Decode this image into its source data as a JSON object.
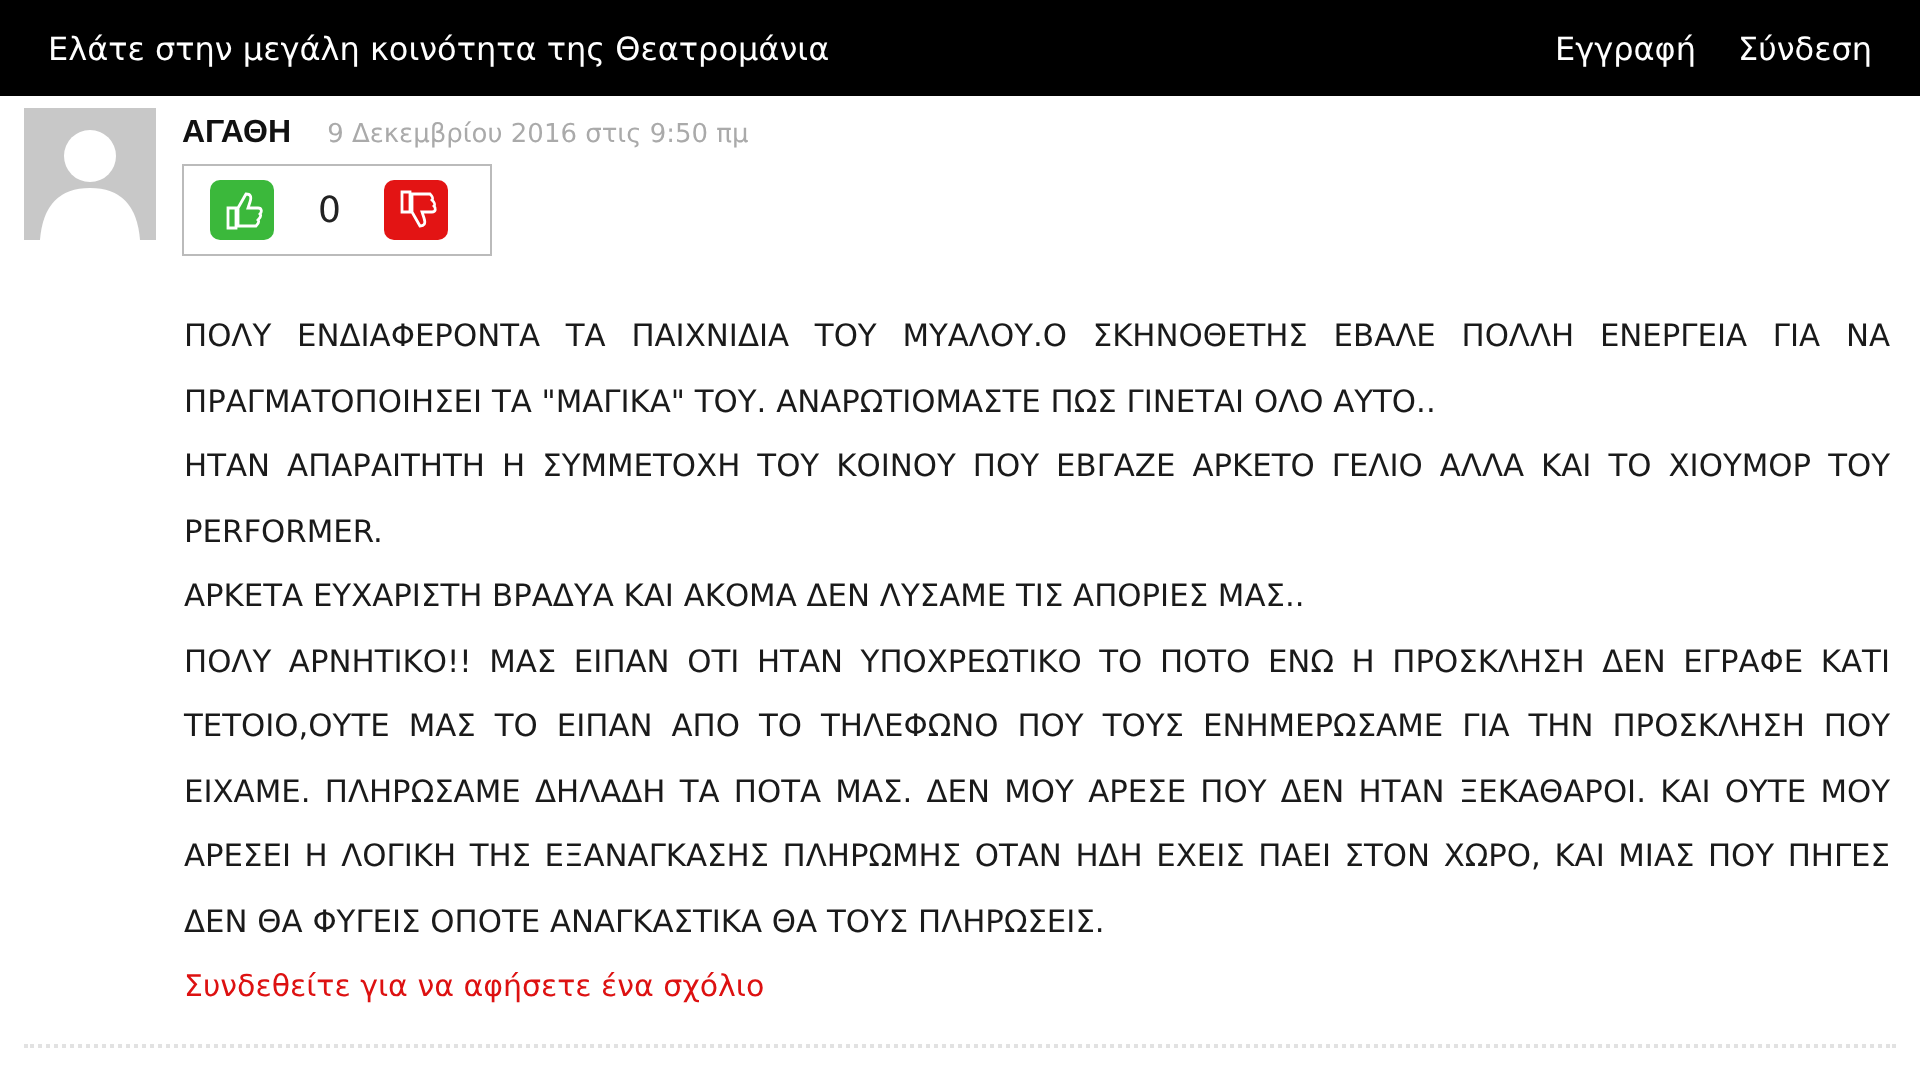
{
  "header": {
    "title": "Ελάτε στην μεγάλη κοινότητα της Θεατρομάνια",
    "links": [
      "Εγγραφή",
      "Σύνδεση"
    ]
  },
  "comment": {
    "author": "ΑΓΑΘΗ",
    "date": "9 Δεκεμβρίου 2016 στις 9:50 πμ",
    "votes": "0",
    "paragraphs": [
      "ΠΟΛΥ ΕΝΔΙΑΦΕΡΟΝΤΑ ΤΑ ΠΑΙΧΝΙΔΙΑ ΤΟΥ ΜΥΑΛΟΥ.Ο ΣΚΗΝΟΘΕΤΗΣ ΕΒΑΛΕ ΠΟΛΛΗ ΕΝΕΡΓΕΙΑ ΓΙΑ ΝΑ ΠΡΑΓΜΑΤΟΠΟΙΗΣΕΙ ΤΑ \"ΜΑΓΙΚΑ\" ΤΟΥ. ΑΝΑΡΩΤΙΟΜΑΣΤΕ ΠΩΣ ΓΙΝΕΤΑΙ ΟΛΟ ΑΥΤΟ..",
      "ΗΤΑΝ ΑΠΑΡΑΙΤΗΤΗ Η ΣΥΜΜΕΤΟΧΗ ΤΟΥ ΚΟΙΝΟΥ ΠΟΥ ΕΒΓΑΖΕ ΑΡΚΕΤΟ ΓΕΛΙΟ ΑΛΛΑ ΚΑΙ ΤΟ ΧΙΟΥΜΟΡ ΤΟΥ PERFORMER.",
      "ΑΡΚΕΤΑ ΕΥΧΑΡΙΣΤΗ ΒΡΑΔΥΑ ΚΑΙ ΑΚΟΜΑ ΔΕΝ ΛΥΣΑΜΕ ΤΙΣ ΑΠΟΡΙΕΣ ΜΑΣ..",
      "ΠΟΛΥ ΑΡΝΗΤΙΚΟ!! ΜΑΣ ΕΙΠΑΝ ΟΤΙ ΗΤΑΝ ΥΠΟΧΡΕΩΤΙΚΟ ΤΟ ΠΟΤΟ ΕΝΩ Η ΠΡΟΣΚΛΗΣΗ ΔΕΝ ΕΓΡΑΦΕ ΚΑΤΙ ΤΕΤΟΙΟ,ΟΥΤΕ ΜΑΣ ΤΟ ΕΙΠΑΝ ΑΠΟ ΤΟ ΤΗΛΕΦΩΝΟ ΠΟΥ ΤΟΥΣ ΕΝΗΜΕΡΩΣΑΜΕ ΓΙΑ ΤΗΝ ΠΡΟΣΚΛΗΣΗ ΠΟΥ ΕΙΧΑΜΕ. ΠΛΗΡΩΣΑΜΕ ΔΗΛΑΔΗ ΤΑ ΠΟΤΑ ΜΑΣ. ΔΕΝ ΜΟΥ ΑΡΕΣΕ ΠΟΥ ΔΕΝ ΗΤΑΝ ΞΕΚΑΘΑΡΟΙ. ΚΑΙ ΟΥΤΕ ΜΟΥ ΑΡΕΣΕΙ Η ΛΟΓΙΚΗ ΤΗΣ ΕΞΑΝΑΓΚΑΣΗΣ ΠΛΗΡΩΜΗΣ ΟΤΑΝ ΗΔΗ ΕΧΕΙΣ ΠΑΕΙ ΣΤΟΝ ΧΩΡΟ, ΚΑΙ ΜΙΑΣ ΠΟΥ ΠΗΓΕΣ ΔΕΝ ΘΑ ΦΥΓΕΙΣ ΟΠΟΤΕ ΑΝΑΓΚΑΣΤΙΚΑ ΘΑ ΤΟΥΣ ΠΛΗΡΩΣΕΙΣ."
    ],
    "login_link": "Συνδεθείτε για να αφήσετε ένα σχόλιο"
  }
}
